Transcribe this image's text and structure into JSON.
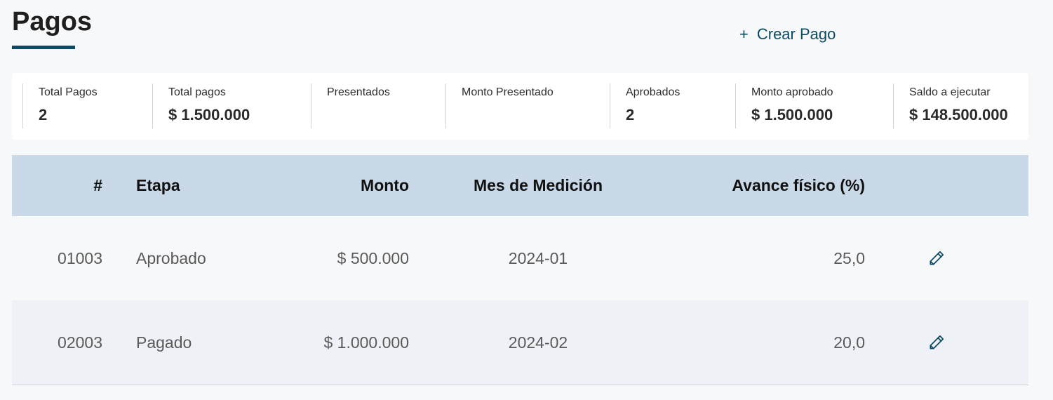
{
  "header": {
    "title": "Pagos",
    "create_label": "Crear Pago",
    "create_icon": "plus-icon"
  },
  "summary": [
    {
      "label": "Total Pagos",
      "value": "2"
    },
    {
      "label": "Total pagos",
      "value": "$ 1.500.000"
    },
    {
      "label": "Presentados",
      "value": ""
    },
    {
      "label": "Monto Presentado",
      "value": ""
    },
    {
      "label": "Aprobados",
      "value": "2"
    },
    {
      "label": "Monto aprobado",
      "value": "$ 1.500.000"
    },
    {
      "label": "Saldo a ejecutar",
      "value": "$ 148.500.000"
    }
  ],
  "table": {
    "columns": [
      "#",
      "Etapa",
      "Monto",
      "Mes de Medición",
      "Avance físico (%)"
    ],
    "rows": [
      {
        "num": "01003",
        "etapa": "Aprobado",
        "monto": "$ 500.000",
        "mes": "2024-01",
        "avance": "25,0",
        "action_icon": "pencil-icon"
      },
      {
        "num": "02003",
        "etapa": "Pagado",
        "monto": "$ 1.000.000",
        "mes": "2024-02",
        "avance": "20,0",
        "action_icon": "pencil-icon"
      }
    ]
  },
  "colors": {
    "accent": "#0d4a63",
    "table_header_bg": "#c9d9e7",
    "row_alt_bg": "#eef1f6",
    "page_bg": "#f7f8fa"
  }
}
